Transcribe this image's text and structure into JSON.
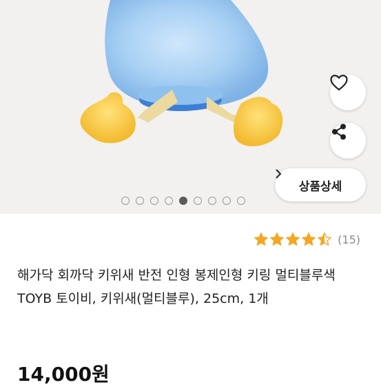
{
  "product": {
    "title": "해가닥 회까닥 키위새 반전 인형 봉제인형 키링 멀티블루색 TOYB 토이비, 키위새(멀티블루), 25cm, 1개",
    "price": "14,000원",
    "rating": {
      "stars": 4.5,
      "max_stars": 5,
      "review_count": "(15)",
      "star_color": "#F5A623"
    },
    "image_gallery": {
      "total": 9,
      "active_index": 5
    }
  },
  "actions": {
    "like_icon": "heart-icon",
    "share_icon": "share-icon",
    "detail_label": "상품상세",
    "detail_icon": "chevron-right-icon"
  }
}
